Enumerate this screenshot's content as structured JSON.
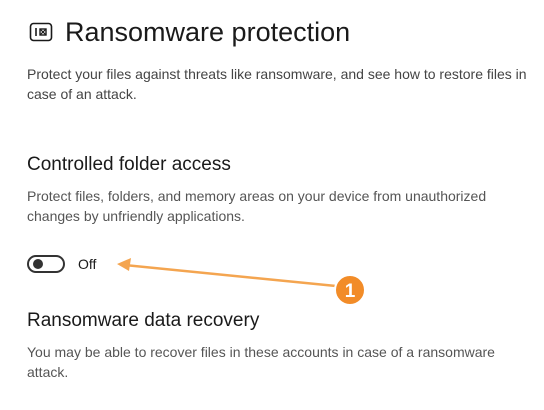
{
  "header": {
    "icon": "ransomware-shield-icon",
    "title": "Ransomware protection"
  },
  "page": {
    "description": "Protect your files against threats like ransomware, and see how to restore files in case of an attack."
  },
  "controlled_folder_access": {
    "title": "Controlled folder access",
    "description": "Protect files, folders, and memory areas on your device from unauthorized changes by unfriendly applications.",
    "toggle_state": "Off",
    "toggle_on": false
  },
  "data_recovery": {
    "title": "Ransomware data recovery",
    "description": "You may be able to recover files in these accounts in case of a ransomware attack."
  },
  "annotation": {
    "number": "1",
    "color": "#F4A550",
    "badge_color": "#F28C28"
  }
}
